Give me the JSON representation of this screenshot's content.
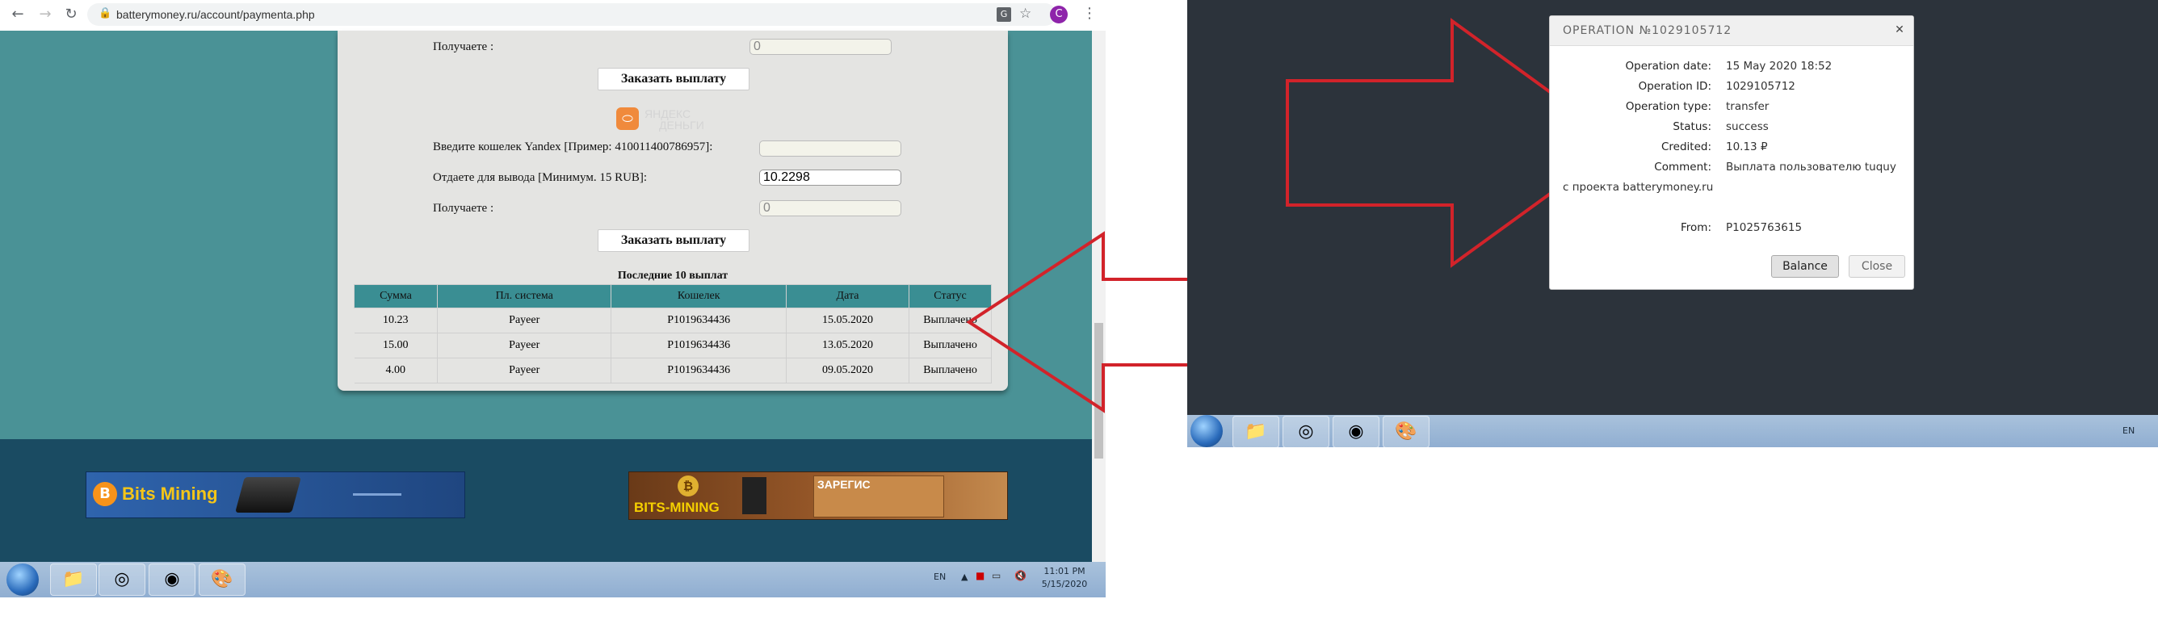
{
  "browser": {
    "url": "batterymoney.ru/account/paymenta.php",
    "profile_initial": "C"
  },
  "form": {
    "receive_label_top": "Получаете :",
    "receive_value_top": "0",
    "order_button_1": "Заказать выплату",
    "yandex_logo_text_1": "ЯНДЕКС",
    "yandex_logo_text_2": "ДЕНЬГИ",
    "wallet_label": "Введите кошелек Yandex [Пример: 410011400786957]:",
    "wallet_value": "",
    "amount_label": "Отдаете для вывода [Минимум. 15 RUB]:",
    "amount_value": "10.2298",
    "receive_label": "Получаете :",
    "receive_value": "0",
    "order_button_2": "Заказать выплату"
  },
  "payouts": {
    "title": "Последние 10 выплат",
    "headers": [
      "Сумма",
      "Пл. система",
      "Кошелек",
      "Дата",
      "Статус"
    ],
    "rows": [
      [
        "10.23",
        "Payeer",
        "P1019634436",
        "15.05.2020",
        "Выплачено"
      ],
      [
        "15.00",
        "Payeer",
        "P1019634436",
        "13.05.2020",
        "Выплачено"
      ],
      [
        "4.00",
        "Payeer",
        "P1019634436",
        "09.05.2020",
        "Выплачено"
      ]
    ]
  },
  "banners": {
    "left_text": "Bits Mining",
    "right_text_1": "ЗАРЕГИС",
    "right_text_2": "BITS-MINING"
  },
  "taskbar_left": {
    "lang": "EN",
    "time": "11:01 PM",
    "date": "5/15/2020"
  },
  "taskbar_right": {
    "lang": "EN"
  },
  "operation": {
    "title": "OPERATION №1029105712",
    "fields": [
      {
        "label": "Operation date:",
        "value": "15 May 2020 18:52"
      },
      {
        "label": "Operation ID:",
        "value": "1029105712"
      },
      {
        "label": "Operation type:",
        "value": "transfer"
      },
      {
        "label": "Status:",
        "value": "success"
      },
      {
        "label": "Credited:",
        "value": "10.13 ₽"
      },
      {
        "label": "Comment:",
        "value": "Выплата пользователю tuquy"
      }
    ],
    "comment_continued": "с проекта batterymoney.ru",
    "from_label": "From:",
    "from_value": "P1025763615",
    "balance_button": "Balance",
    "close_button": "Close"
  },
  "colors": {
    "arrow": "#d2232a",
    "teal": "#4a9296",
    "dark_blue": "#1a4b62"
  }
}
